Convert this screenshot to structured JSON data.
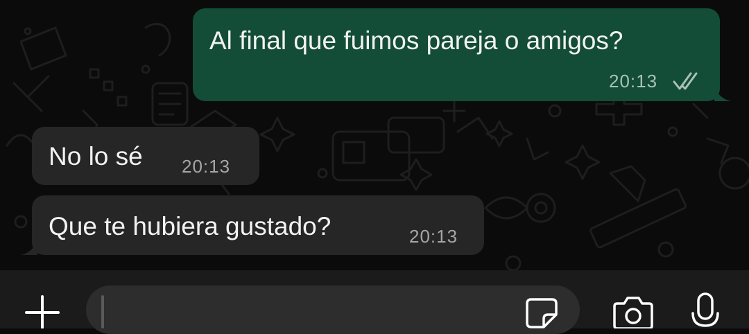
{
  "messages": [
    {
      "direction": "outgoing",
      "text": "Al final que fuimos pareja o amigos?",
      "time": "20:13",
      "status_icon": "double-check-icon"
    },
    {
      "direction": "incoming",
      "text": "No lo sé",
      "time": "20:13"
    },
    {
      "direction": "incoming",
      "text": "Que te hubiera gustado?",
      "time": "20:13"
    }
  ],
  "composer": {
    "placeholder": "",
    "value": "",
    "icons": {
      "attach": "plus-icon",
      "sticker": "sticker-icon",
      "camera": "camera-icon",
      "voice": "microphone-icon"
    }
  },
  "colors": {
    "background": "#0b0b0b",
    "outgoing_bubble": "#134d37",
    "incoming_bubble": "#262626",
    "input_bar": "#1b1b1b",
    "input_field": "#2d2d2d",
    "icon": "#ffffff"
  }
}
